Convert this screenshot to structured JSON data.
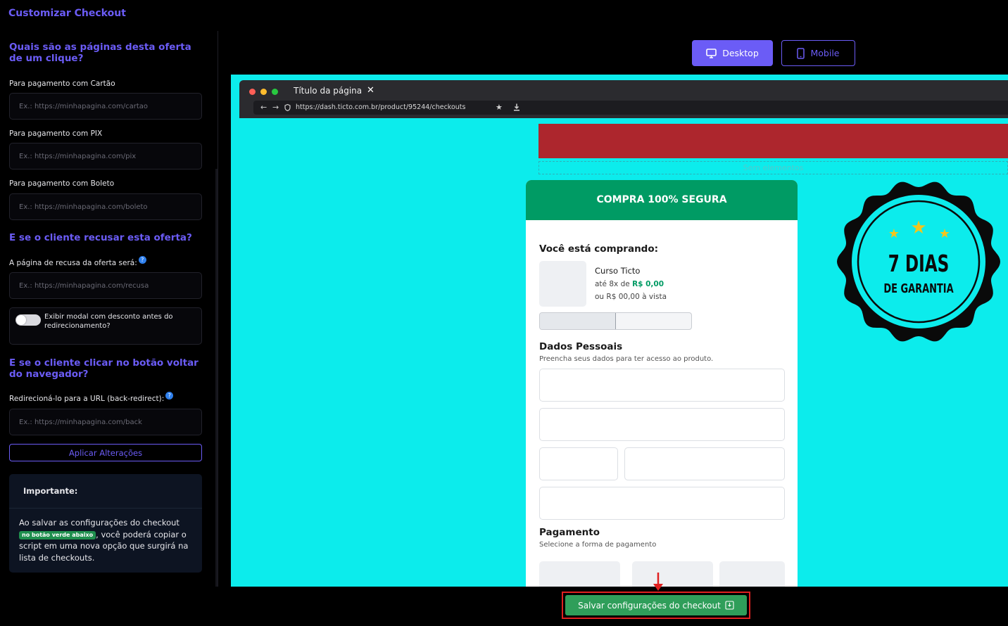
{
  "header": {
    "title": "Customizar Checkout"
  },
  "sidebar": {
    "section_pages": "Quais são as páginas desta oferta de um clique?",
    "card_label": "Para pagamento com Cartão",
    "card_placeholder": "Ex.: https://minhapagina.com/cartao",
    "pix_label": "Para pagamento com PIX",
    "pix_placeholder": "Ex.: https://minhapagina.com/pix",
    "boleto_label": "Para pagamento com Boleto",
    "boleto_placeholder": "Ex.: https://minhapagina.com/boleto",
    "section_refuse": "E se o cliente recusar esta oferta?",
    "refuse_label": "A página de recusa da oferta será:",
    "refuse_placeholder": "Ex.: https://minhapagina.com/recusa",
    "modal_toggle_label": "Exibir modal com desconto antes do redirecionamento?",
    "section_back": "E se o cliente clicar no botão voltar do navegador?",
    "back_label": "Redirecioná-lo para a URL (back-redirect):",
    "back_placeholder": "Ex.: https://minhapagina.com/back",
    "apply_button": "Aplicar Alterações",
    "help_glyph": "?",
    "note": {
      "title": "Importante:",
      "text_before": "Ao salvar as configurações do checkout ",
      "badge": "no botão verde abaixo",
      "text_after": ", você poderá copiar o script em uma nova opção que surgirá na lista de checkouts."
    }
  },
  "view_toggle": {
    "desktop": "Desktop",
    "mobile": "Mobile",
    "active": "desktop"
  },
  "browser": {
    "tab_title": "Título da página",
    "url": "https://dash.ticto.com.br/product/95244/checkouts"
  },
  "preview": {
    "banner_color": "#ad262d",
    "empty_zone": "Sem elementos",
    "card": {
      "header": "COMPRA 100% SEGURA",
      "buying_title": "Você está comprando:",
      "product_name": "Curso Ticto",
      "installments_prefix": "até 8x de",
      "installments_value": "R$ 0,00",
      "cash_price": "ou R$ 00,00 à vista",
      "personal_title": "Dados Pessoais",
      "personal_subtitle": "Preencha seus dados para ter acesso ao produto.",
      "payment_title": "Pagamento",
      "payment_subtitle": "Selecione a forma de pagamento"
    },
    "seal": {
      "line1": "7 DIAS",
      "line2": "DE GARANTIA"
    }
  },
  "footer": {
    "save_button": "Salvar configurações do checkout"
  },
  "colors": {
    "accent": "#6b5cf6",
    "preview_bg": "#0cecec",
    "success": "#009b64",
    "save": "#2f9e5a",
    "highlight": "#e02020"
  }
}
